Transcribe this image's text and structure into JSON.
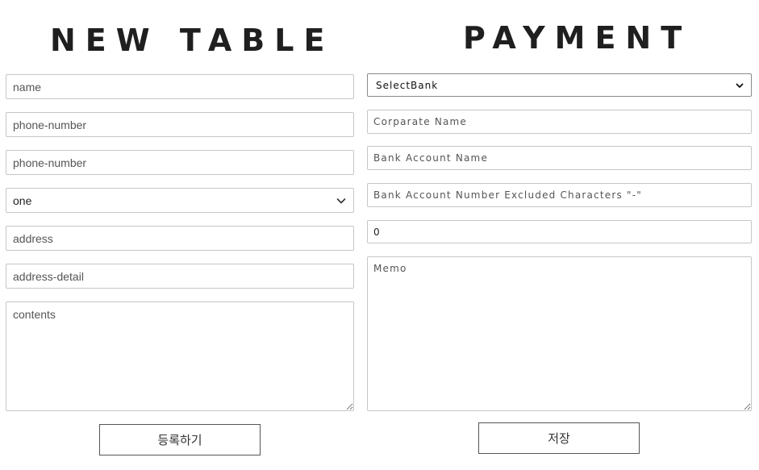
{
  "new_table": {
    "title": "NEW TABLE",
    "name_placeholder": "name",
    "phone_placeholder": "phone-number",
    "phone2_placeholder": "phone-number",
    "select_value": "one",
    "address_placeholder": "address",
    "address_detail_placeholder": "address-detail",
    "contents_placeholder": "contents",
    "submit_label": "등록하기"
  },
  "payment": {
    "title": "PAYMENT",
    "bank_select_value": "SelectBank",
    "corporate_placeholder": "Corparate Name",
    "account_name_placeholder": "Bank Account Name",
    "account_number_placeholder": "Bank Account Number Excluded Characters \"-\"",
    "amount_value": "0",
    "memo_placeholder": "Memo",
    "save_label": "저장"
  },
  "icons": {
    "select_chevron": "chevron-down-icon",
    "bank_select_arrows": "select-arrows-icon"
  }
}
